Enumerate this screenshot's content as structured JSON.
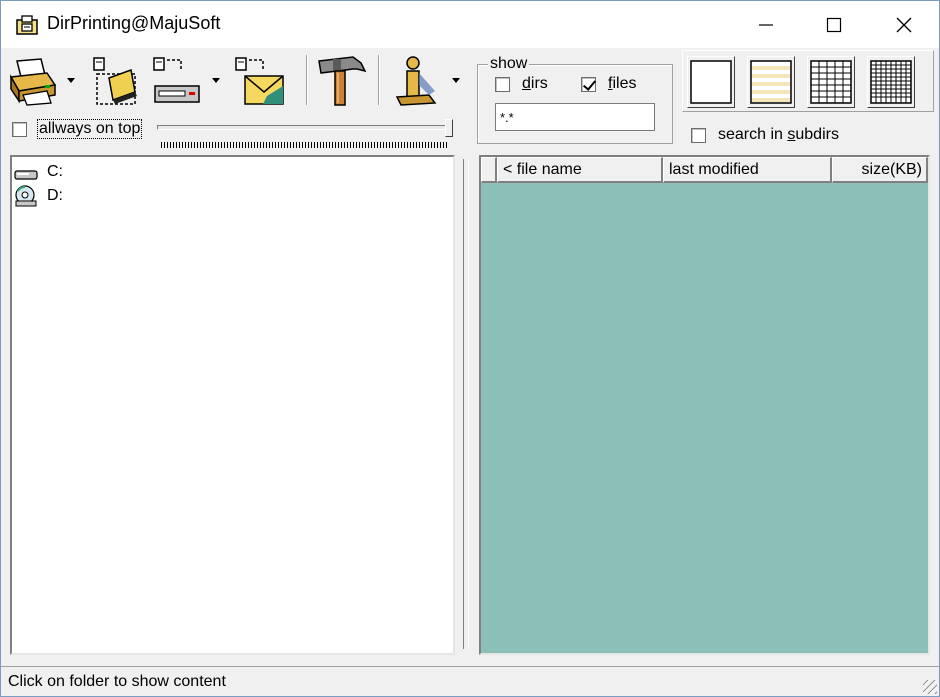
{
  "window": {
    "title": "DirPrinting@MajuSoft",
    "controls": {
      "minimize": "minimize-icon",
      "maximize": "maximize-icon",
      "close": "close-icon"
    }
  },
  "toolbar": {
    "tools": [
      {
        "name": "printer-icon",
        "has_dropdown": true
      },
      {
        "name": "export-file-icon",
        "has_dropdown": false
      },
      {
        "name": "export-drive-icon",
        "has_dropdown": true
      },
      {
        "name": "email-icon",
        "has_dropdown": false
      },
      {
        "name": "hammer-icon",
        "has_dropdown": false
      },
      {
        "name": "info-icon",
        "has_dropdown": true
      }
    ],
    "always_on_top": {
      "label": "allways on top",
      "checked": false
    }
  },
  "show": {
    "title": "show",
    "dirs_label": "dirs",
    "dirs_checked": false,
    "files_label": "files",
    "files_checked": true,
    "filter_value": "*.*",
    "search_subdirs_label": "search in subdirs",
    "search_subdirs_checked": false
  },
  "view_styles": [
    "blank-view-icon",
    "striped-view-icon",
    "grid-view-icon",
    "fine-grid-view-icon"
  ],
  "tree": {
    "items": [
      {
        "label": "C:",
        "icon": "hard-drive-icon"
      },
      {
        "label": "D:",
        "icon": "cd-drive-icon"
      }
    ]
  },
  "file_list": {
    "columns": [
      "",
      "< file name",
      "last modified",
      "size(KB)"
    ],
    "background": "#8cbfb8"
  },
  "status": {
    "text": "Click on folder to show content"
  }
}
